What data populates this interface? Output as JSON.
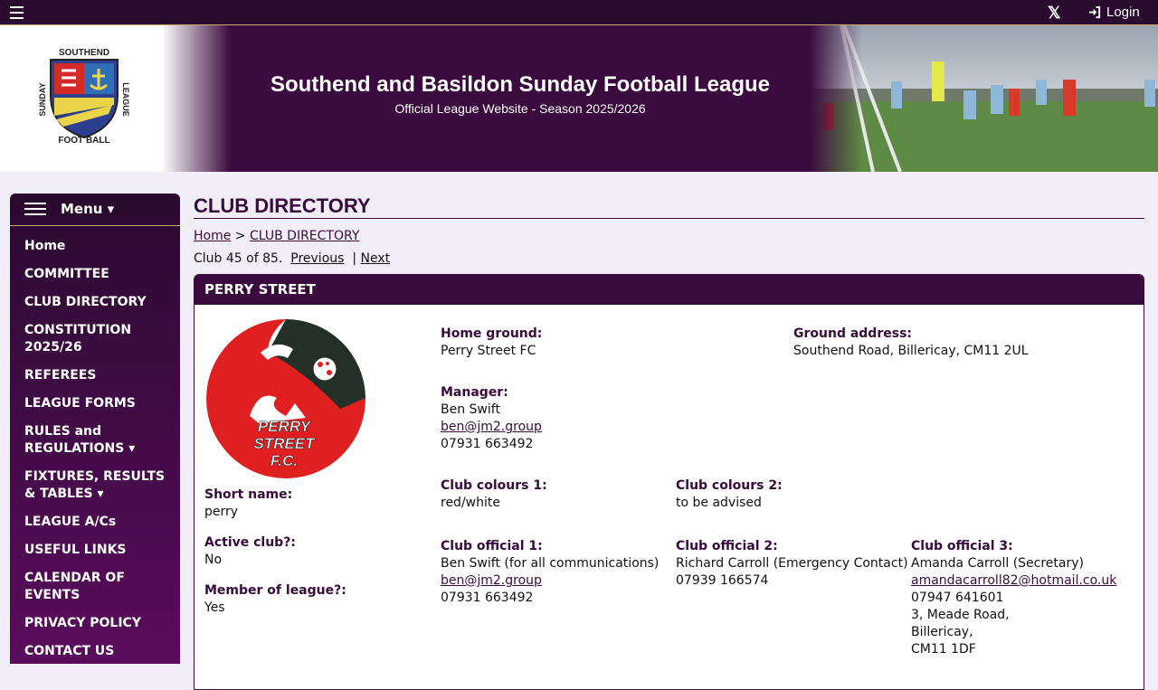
{
  "topbar": {
    "login_label": "Login",
    "x_icon": "x-twitter-icon"
  },
  "banner": {
    "title": "Southend and Basildon Sunday Football League",
    "subtitle": "Official League Website - Season 2025/2026",
    "logo": {
      "top_text": "SOUTHEND",
      "left_text": "SUNDAY",
      "right_text": "LEAGUE",
      "bottom_text": "FOOT BALL"
    }
  },
  "sidebar": {
    "menu_label": "Menu ▾",
    "items": [
      "Home",
      "COMMITTEE",
      "CLUB DIRECTORY",
      "CONSTITUTION 2025/26",
      "REFEREES",
      "LEAGUE FORMS",
      "RULES and REGULATIONS ▾",
      "FIXTURES, RESULTS & TABLES ▾",
      "LEAGUE A/Cs",
      "USEFUL LINKS",
      "CALENDAR OF EVENTS",
      "PRIVACY POLICY",
      "CONTACT US"
    ]
  },
  "main": {
    "page_title": "CLUB DIRECTORY",
    "breadcrumb": {
      "home": "Home",
      "separator": ">",
      "current": "CLUB DIRECTORY"
    },
    "pager": {
      "status": "Club 45 of 85.",
      "previous": "Previous",
      "divider": "|",
      "next": "Next"
    },
    "club": {
      "name": "PERRY STREET",
      "badge_text": [
        "PERRY",
        "STREET",
        "F.C."
      ],
      "short_name_label": "Short name:",
      "short_name": "perry",
      "active_label": "Active club?:",
      "active": "No",
      "member_label": "Member of league?:",
      "member": "Yes",
      "home_ground_label": "Home ground:",
      "home_ground": "Perry Street FC",
      "ground_address_label": "Ground address:",
      "ground_address": "Southend Road, Billericay, CM11 2UL",
      "manager_label": "Manager:",
      "manager_name": "Ben Swift",
      "manager_email": "ben@jm2.group",
      "manager_phone": "07931 663492",
      "colours1_label": "Club colours 1:",
      "colours1": "red/white",
      "colours2_label": "Club colours 2:",
      "colours2": "to be advised",
      "official1_label": "Club official 1:",
      "official1_name": "Ben Swift (for all communications)",
      "official1_email": "ben@jm2.group",
      "official1_phone": "07931 663492",
      "official2_label": "Club official 2:",
      "official2_name": "Richard Carroll (Emergency Contact)",
      "official2_phone": "07939 166574",
      "official3_label": "Club official 3:",
      "official3_name": "Amanda Carroll (Secretary)",
      "official3_email": "amandacarroll82@hotmail.co.uk",
      "official3_phone": "07947 641601",
      "official3_address": [
        "3, Meade Road,",
        "Billericay,",
        "CM11 1DF"
      ]
    }
  },
  "colors": {
    "brand": "#3a0a3e",
    "accent_gold": "#c8a86a",
    "badge_red": "#e02020",
    "badge_dark": "#233028"
  }
}
